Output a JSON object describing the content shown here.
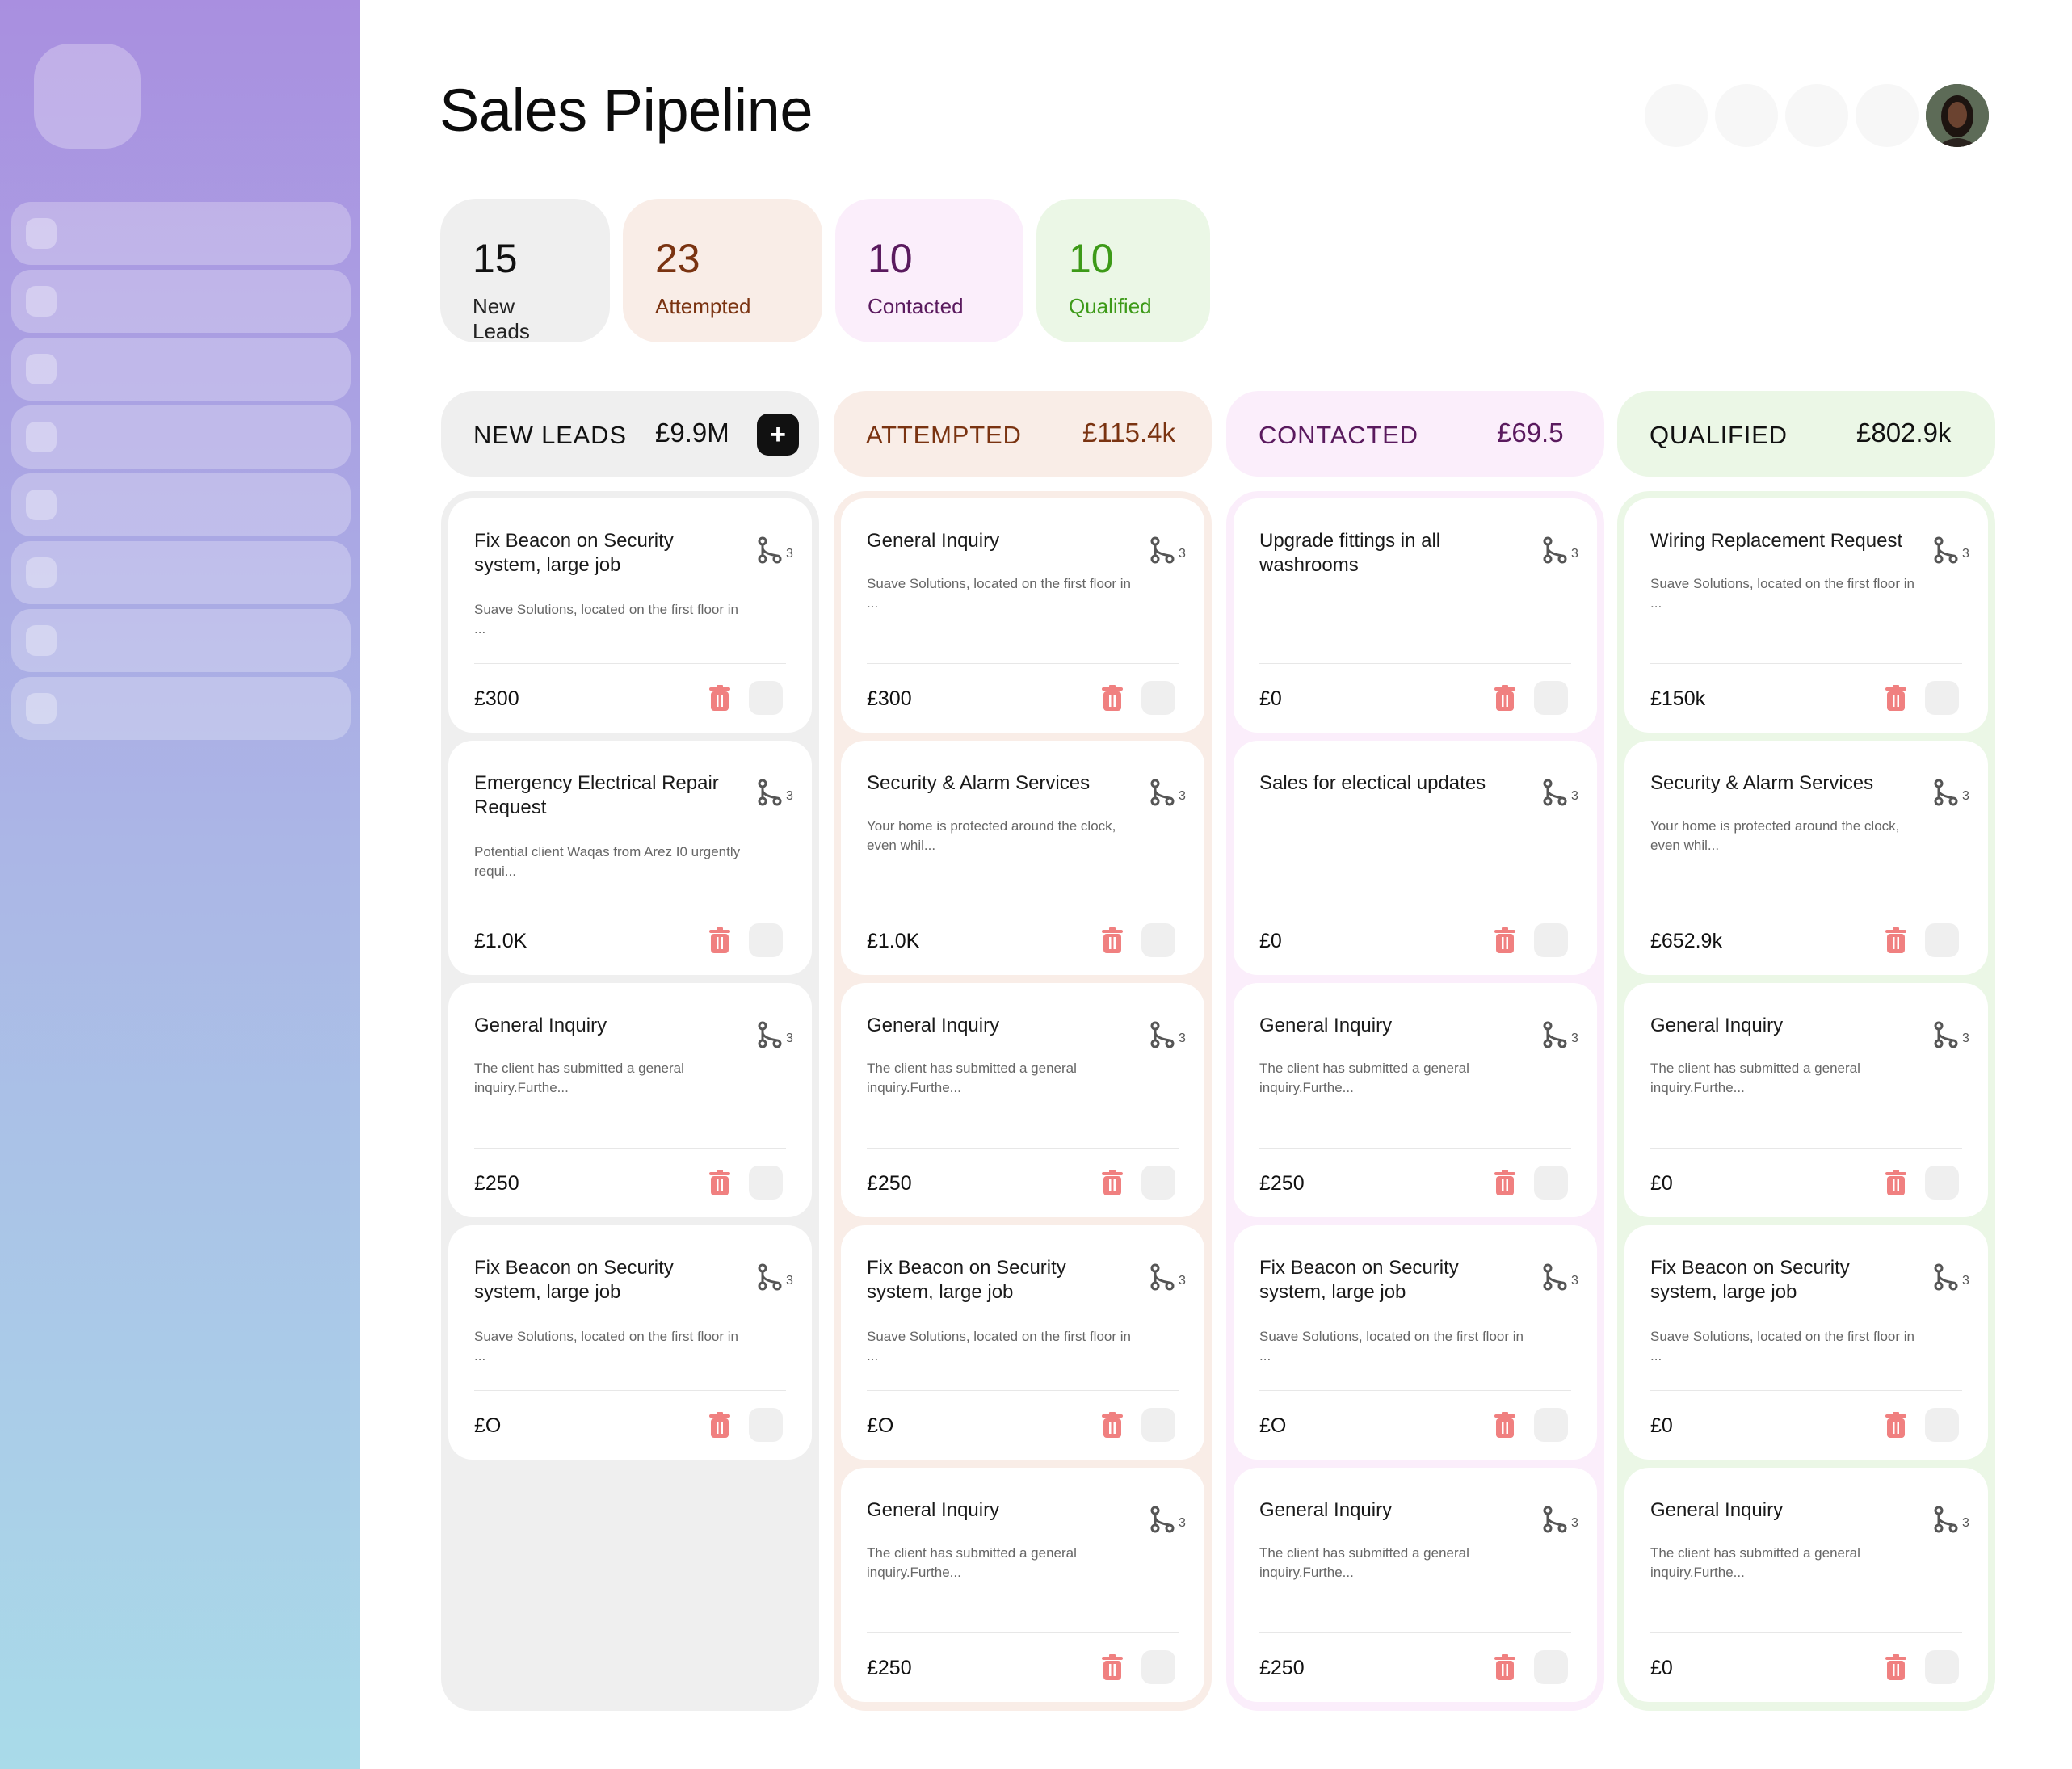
{
  "page": {
    "title": "Sales Pipeline"
  },
  "stats": [
    {
      "value": "15",
      "label": "New Leads"
    },
    {
      "value": "23",
      "label": "Attempted"
    },
    {
      "value": "10",
      "label": "Contacted"
    },
    {
      "value": "10",
      "label": "Qualified"
    }
  ],
  "columns": [
    {
      "name": "NEW LEADS",
      "total": "£9.9M",
      "add_label": "+",
      "cards": [
        {
          "title": "Fix Beacon on Security system, large job",
          "desc": "Suave Solutions, located on the first floor in ...",
          "branches": "3",
          "amount": "£300"
        },
        {
          "title": "Emergency Electrical Repair Request",
          "desc": "Potential client Waqas from Arez I0 urgently requi...",
          "branches": "3",
          "amount": "£1.0K"
        },
        {
          "title": "General Inquiry",
          "desc": "The client has submitted a general inquiry.Furthe...",
          "branches": "3",
          "amount": "£250"
        },
        {
          "title": "Fix Beacon on Security system, large job",
          "desc": "Suave Solutions, located on the first floor in ...",
          "branches": "3",
          "amount": "£O"
        }
      ]
    },
    {
      "name": "ATTEMPTED",
      "total": "£115.4k",
      "cards": [
        {
          "title": "General Inquiry",
          "desc": "Suave Solutions, located on the first floor in ...",
          "branches": "3",
          "amount": "£300"
        },
        {
          "title": "Security & Alarm Services",
          "desc": "Your home is protected around the clock, even whil...",
          "branches": "3",
          "amount": "£1.0K"
        },
        {
          "title": "General Inquiry",
          "desc": "The client has submitted a general inquiry.Furthe...",
          "branches": "3",
          "amount": "£250"
        },
        {
          "title": "Fix Beacon on Security system, large job",
          "desc": "Suave Solutions, located on the first floor in ...",
          "branches": "3",
          "amount": "£O"
        },
        {
          "title": "General Inquiry",
          "desc": "The client has submitted a general inquiry.Furthe...",
          "branches": "3",
          "amount": "£250"
        }
      ]
    },
    {
      "name": "CONTACTED",
      "total": "£69.5",
      "cards": [
        {
          "title": "Upgrade fittings in all washrooms",
          "desc": "",
          "branches": "3",
          "amount": "£0"
        },
        {
          "title": "Sales for electical updates",
          "desc": "",
          "branches": "3",
          "amount": "£0"
        },
        {
          "title": "General Inquiry",
          "desc": "The client has submitted a general inquiry.Furthe...",
          "branches": "3",
          "amount": "£250"
        },
        {
          "title": "Fix Beacon on Security system, large job",
          "desc": "Suave Solutions, located on the first floor in ...",
          "branches": "3",
          "amount": "£O"
        },
        {
          "title": "General Inquiry",
          "desc": "The client has submitted a general inquiry.Furthe...",
          "branches": "3",
          "amount": "£250"
        }
      ]
    },
    {
      "name": "QUALIFIED",
      "total": "£802.9k",
      "cards": [
        {
          "title": "Wiring Replacement Request",
          "desc": "Suave Solutions, located on the first floor in ...",
          "branches": "3",
          "amount": "£150k"
        },
        {
          "title": "Security & Alarm Services",
          "desc": "Your home is protected around the clock, even whil...",
          "branches": "3",
          "amount": "£652.9k"
        },
        {
          "title": "General Inquiry",
          "desc": "The client has submitted a general inquiry.Furthe...",
          "branches": "3",
          "amount": "£0"
        },
        {
          "title": "Fix Beacon on Security system, large job",
          "desc": "Suave Solutions, located on the first floor in ...",
          "branches": "3",
          "amount": "£0"
        },
        {
          "title": "General Inquiry",
          "desc": "The client has submitted a general inquiry.Furthe...",
          "branches": "3",
          "amount": "£0"
        }
      ]
    }
  ],
  "colors": {
    "new_leads": "#111111",
    "attempted": "#7a3311",
    "contacted": "#5a1a5e",
    "qualified": "#3d9a18",
    "trash": "#f08080"
  },
  "icons": {
    "branch": "branch-icon",
    "trash": "trash-icon",
    "add": "plus-icon"
  }
}
